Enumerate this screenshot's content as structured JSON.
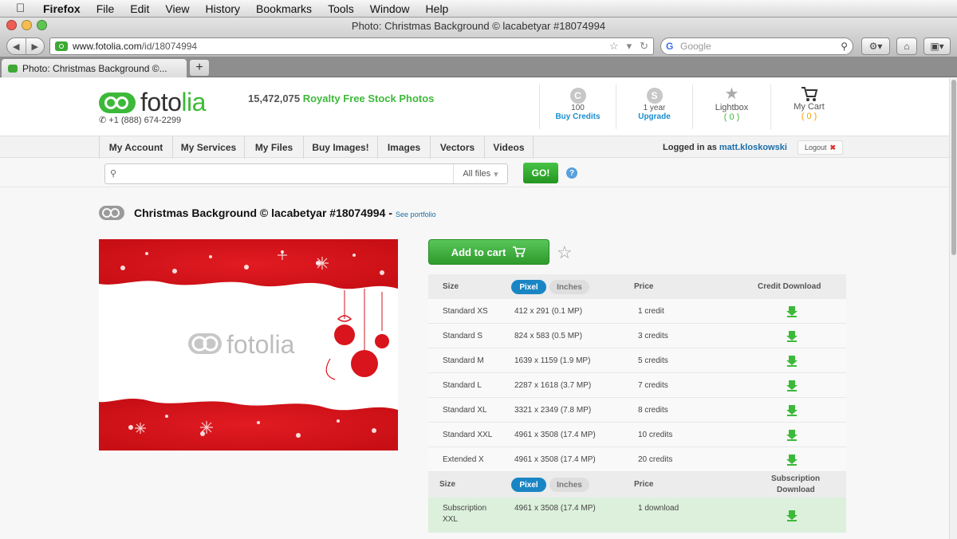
{
  "menubar": {
    "app": "Firefox",
    "items": [
      "File",
      "Edit",
      "View",
      "History",
      "Bookmarks",
      "Tools",
      "Window",
      "Help"
    ]
  },
  "window": {
    "title": "Photo: Christmas Background © lacabetyar #18074994"
  },
  "toolbar": {
    "url_host": "www.fotolia.com",
    "url_path": "/id/18074994",
    "search_placeholder": "Google"
  },
  "tab": {
    "label": "Photo: Christmas Background ©...",
    "new_tab": "+"
  },
  "site": {
    "logo_prefix": "foto",
    "logo_suffix": "lia",
    "phone": "+1 (888) 674-2299",
    "tagline_count": "15,472,075",
    "tagline_text": "Royalty Free Stock Photos",
    "credits": {
      "icon_letter": "C",
      "value": "100",
      "link": "Buy Credits"
    },
    "subscription": {
      "icon_letter": "S",
      "value": "1 year",
      "link": "Upgrade"
    },
    "lightbox": {
      "label": "Lightbox",
      "count": "( 0 )"
    },
    "cart": {
      "label": "My Cart",
      "count": "( 0 )"
    }
  },
  "nav": {
    "items": [
      "My Account",
      "My Services",
      "My Files",
      "Buy Images!",
      "Images",
      "Vectors",
      "Videos"
    ],
    "logged_prefix": "Logged in as",
    "username": "matt.kloskowski",
    "logout": "Logout"
  },
  "search": {
    "filter": "All files",
    "go": "GO!",
    "help": "?"
  },
  "photo": {
    "title": "Christmas Background © lacabetyar #18074994",
    "dash": "-",
    "portfolio_link": "See portfolio",
    "watermark_prefix": "foto",
    "watermark_suffix": "lia"
  },
  "cart": {
    "add_label": "Add to cart"
  },
  "pricing": {
    "header": {
      "size": "Size",
      "pixel": "Pixel",
      "inches": "Inches",
      "price": "Price",
      "download": "Credit Download"
    },
    "rows": [
      {
        "size": "Standard XS",
        "dims": "412 x 291 (0.1 MP)",
        "price": "1 credit"
      },
      {
        "size": "Standard S",
        "dims": "824 x 583 (0.5 MP)",
        "price": "3 credits"
      },
      {
        "size": "Standard M",
        "dims": "1639 x 1159 (1.9 MP)",
        "price": "5 credits"
      },
      {
        "size": "Standard L",
        "dims": "2287 x 1618 (3.7 MP)",
        "price": "7 credits"
      },
      {
        "size": "Standard XL",
        "dims": "3321 x 2349 (7.8 MP)",
        "price": "8 credits"
      },
      {
        "size": "Standard XXL",
        "dims": "4961 x 3508 (17.4 MP)",
        "price": "10 credits"
      },
      {
        "size": "Extended X",
        "dims": "4961 x 3508 (17.4 MP)",
        "price": "20 credits"
      }
    ],
    "sub_header": {
      "size": "Size",
      "pixel": "Pixel",
      "inches": "Inches",
      "price": "Price",
      "download_l1": "Subscription",
      "download_l2": "Download"
    },
    "sub_row": {
      "size_l1": "Subscription",
      "size_l2": "XXL",
      "dims": "4961 x 3508 (17.4 MP)",
      "price": "1 download"
    }
  },
  "colors": {
    "brand_green": "#3db93a",
    "link_blue": "#1a85c4",
    "subscription_row": "#dcf0dc"
  }
}
